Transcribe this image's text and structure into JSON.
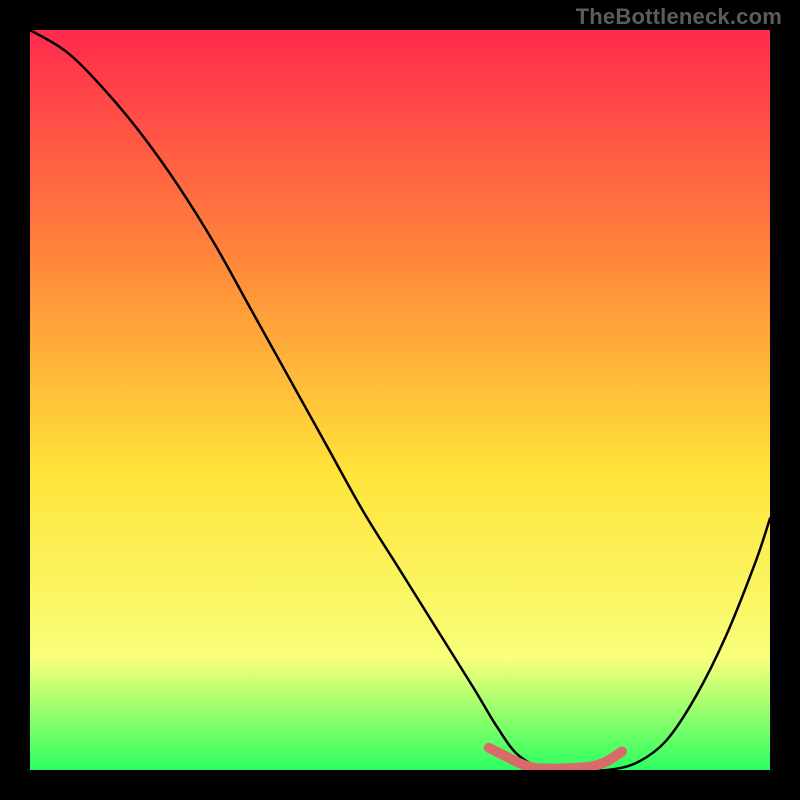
{
  "watermark": "TheBottleneck.com",
  "chart_data": {
    "type": "line",
    "title": "",
    "xlabel": "",
    "ylabel": "",
    "xlim": [
      0,
      100
    ],
    "ylim": [
      0,
      100
    ],
    "grid": false,
    "legend": false,
    "gradient_colors": {
      "top": "#ff2a4d",
      "mid_upper": "#ff8a3a",
      "mid": "#ffe43a",
      "mid_lower": "#f8ff7a",
      "bottom": "#2bff60"
    },
    "series": [
      {
        "name": "bottleneck-curve",
        "color": "#000000",
        "x": [
          0,
          5,
          10,
          15,
          20,
          25,
          30,
          35,
          40,
          45,
          50,
          55,
          60,
          63,
          66,
          70,
          74,
          78,
          82,
          86,
          90,
          94,
          98,
          100
        ],
        "values": [
          100,
          97,
          92,
          86,
          79,
          71,
          62,
          53,
          44,
          35,
          27,
          19,
          11,
          6,
          2,
          0,
          0,
          0,
          1,
          4,
          10,
          18,
          28,
          34
        ]
      },
      {
        "name": "optimal-highlight",
        "color": "#d96a6a",
        "thick": true,
        "x": [
          62,
          64,
          66,
          68,
          70,
          72,
          74,
          76,
          78,
          80
        ],
        "values": [
          3,
          2,
          1,
          0.3,
          0.2,
          0.2,
          0.3,
          0.5,
          1.2,
          2.5
        ]
      }
    ],
    "annotations": []
  }
}
